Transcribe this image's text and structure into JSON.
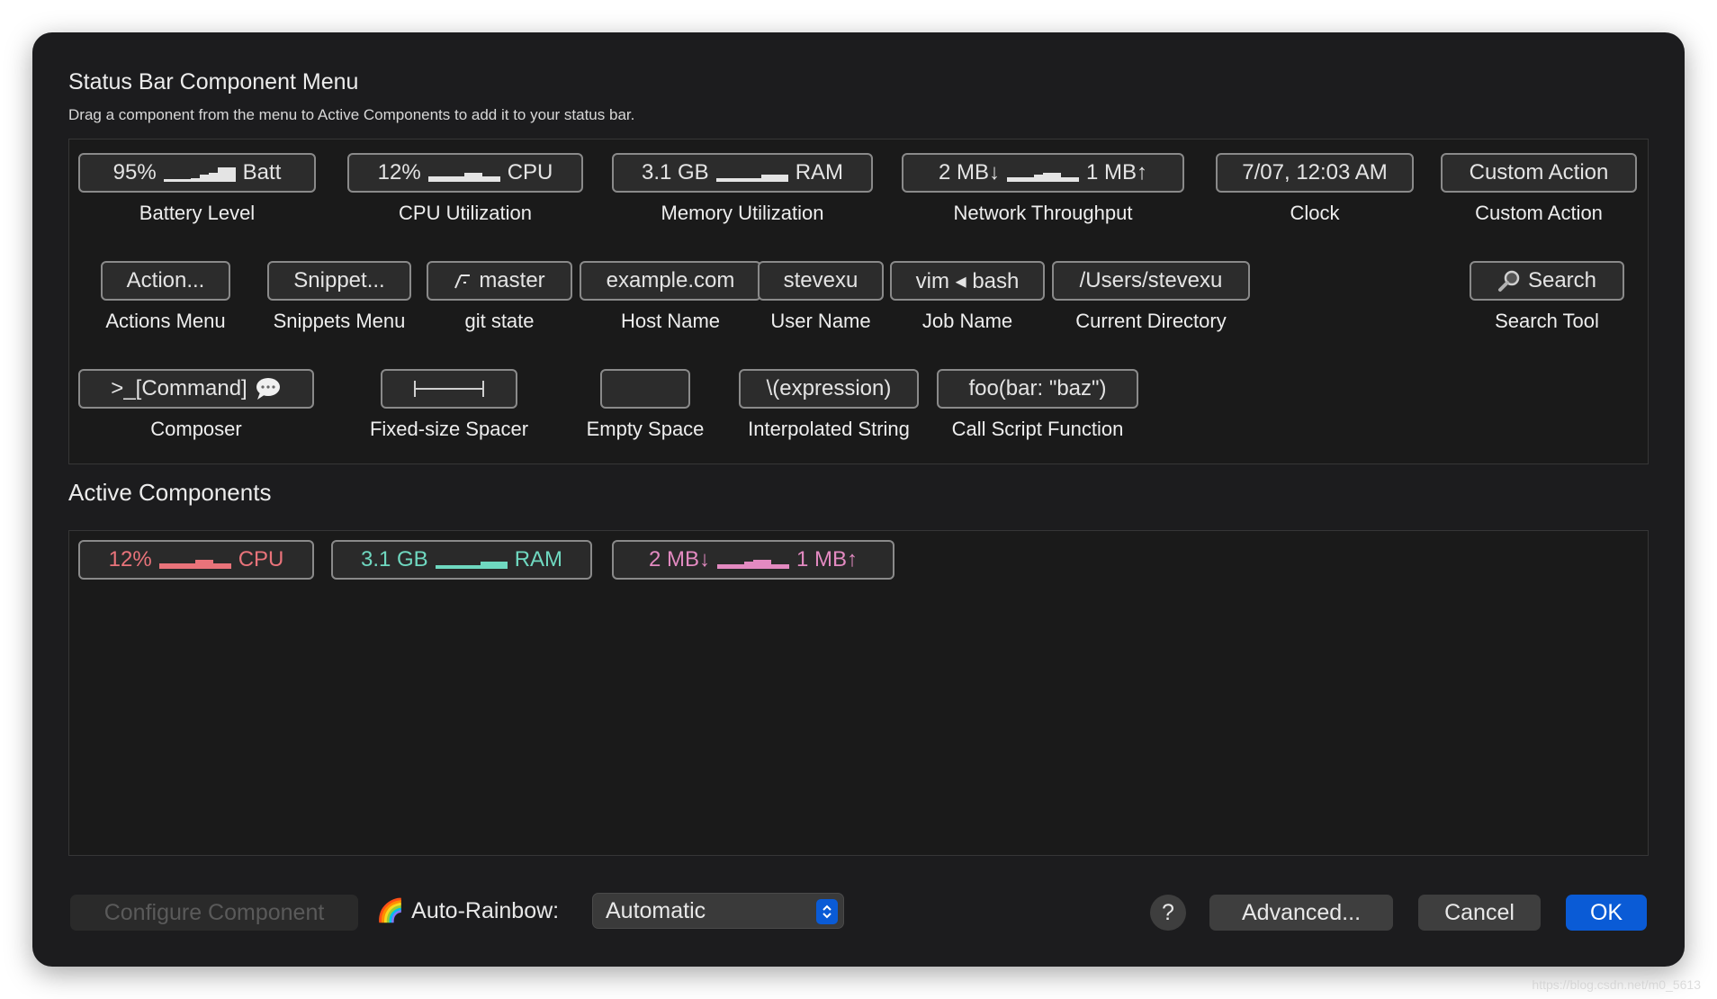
{
  "dialog": {
    "title": "Status Bar Component Menu",
    "subtitle": "Drag a component from the menu to Active Components to add it to your status bar."
  },
  "menu": {
    "row1": [
      {
        "chip_left": "95%",
        "chip_right": "Batt",
        "caption": "Battery Level",
        "spark": [
          3,
          3,
          3,
          4,
          8,
          10,
          16,
          16
        ]
      },
      {
        "chip_left": "12%",
        "chip_right": "CPU",
        "caption": "CPU Utilization",
        "spark": [
          6,
          6,
          6,
          6,
          10,
          10,
          6,
          6
        ]
      },
      {
        "chip_left": "3.1 GB",
        "chip_right": "RAM",
        "caption": "Memory Utilization",
        "spark": [
          4,
          4,
          4,
          4,
          4,
          8,
          8,
          8
        ]
      },
      {
        "chip_left": "2 MB↓",
        "chip_right": "1 MB↑",
        "caption": "Network Throughput",
        "spark": [
          5,
          5,
          5,
          8,
          10,
          10,
          5,
          5
        ]
      },
      {
        "chip_text": "7/07, 12:03 AM",
        "caption": "Clock"
      },
      {
        "chip_text": "Custom Action",
        "caption": "Custom Action"
      }
    ],
    "row2": [
      {
        "chip_text": "Action...",
        "caption": "Actions Menu"
      },
      {
        "chip_text": "Snippet...",
        "caption": "Snippets Menu"
      },
      {
        "chip_text": "master",
        "caption": "git state",
        "icon": "git-branch-icon"
      },
      {
        "chip_text": "example.com",
        "caption": "Host Name"
      },
      {
        "chip_text": "stevexu",
        "caption": "User Name"
      },
      {
        "chip_text": "vim ◂ bash",
        "caption": "Job Name"
      },
      {
        "chip_text": "/Users/stevexu",
        "caption": "Current Directory"
      },
      {
        "chip_text": "Search",
        "caption": "Search Tool",
        "icon": "magnifier-icon"
      }
    ],
    "row3": [
      {
        "chip_text": ">_[Command]",
        "caption": "Composer",
        "icon": "speech-bubble-icon"
      },
      {
        "chip_text": "",
        "caption": "Fixed-size Spacer",
        "icon": "spacer-bar-icon"
      },
      {
        "chip_text": "",
        "caption": "Empty Space"
      },
      {
        "chip_text": "\\(expression)",
        "caption": "Interpolated String"
      },
      {
        "chip_text": "foo(bar: \"baz\")",
        "caption": "Call Script Function"
      }
    ]
  },
  "active": {
    "title": "Active Components",
    "items": [
      {
        "left": "12%",
        "right": "CPU",
        "color": "#e9737a",
        "spark": [
          6,
          6,
          6,
          6,
          10,
          10,
          6,
          6
        ]
      },
      {
        "left": "3.1 GB",
        "right": "RAM",
        "color": "#6fd8c0",
        "spark": [
          4,
          4,
          4,
          4,
          4,
          8,
          8,
          8
        ]
      },
      {
        "left": "2 MB↓",
        "right": "1 MB↑",
        "color": "#e38ac1",
        "spark": [
          5,
          5,
          5,
          8,
          10,
          10,
          5,
          5
        ]
      }
    ]
  },
  "footer": {
    "configure_label": "Configure Component",
    "rainbow_label": "Auto-Rainbow:",
    "rainbow_icon": "🌈",
    "select_value": "Automatic",
    "help_label": "?",
    "advanced_label": "Advanced...",
    "cancel_label": "Cancel",
    "ok_label": "OK"
  },
  "colors": {
    "accent": "#0a5bd6",
    "window_bg": "#1c1c1e",
    "chip_border": "#8a8a8a"
  },
  "watermark": "https://blog.csdn.net/m0_5613"
}
